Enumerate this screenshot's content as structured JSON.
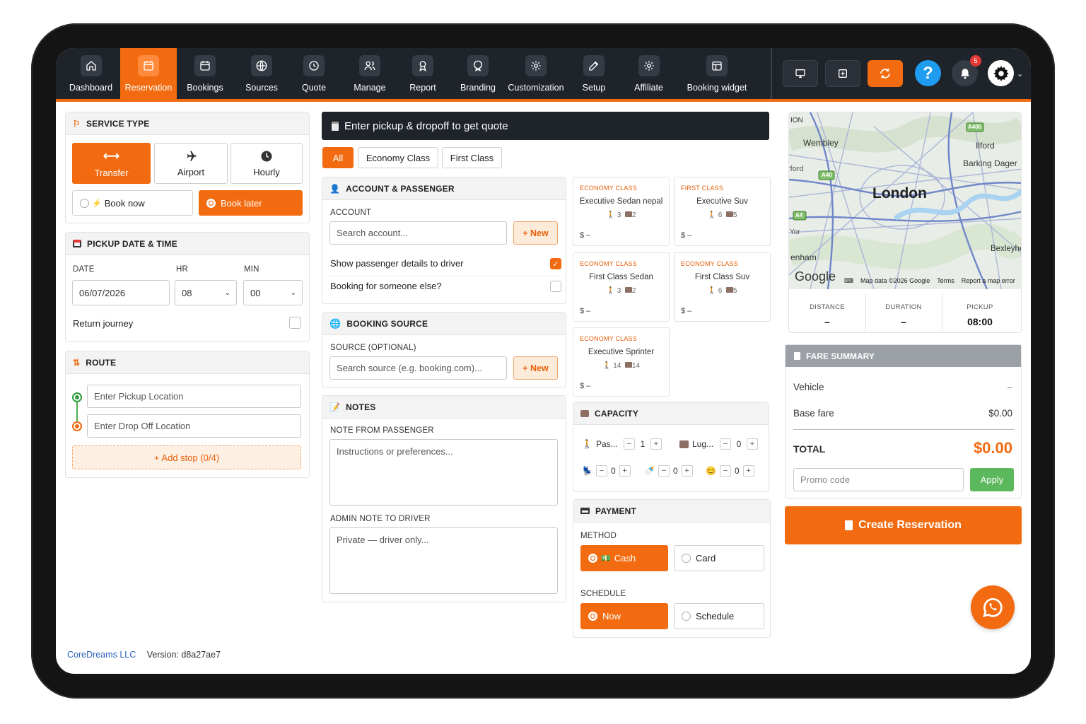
{
  "nav": {
    "items": [
      {
        "label": "Dashboard",
        "icon": "home-icon"
      },
      {
        "label": "Reservation",
        "icon": "calendar-icon",
        "active": true
      },
      {
        "label": "Bookings",
        "icon": "calendar-icon"
      },
      {
        "label": "Sources",
        "icon": "globe-icon"
      },
      {
        "label": "Quote",
        "icon": "quote-icon"
      },
      {
        "label": "Manage",
        "icon": "users-icon"
      },
      {
        "label": "Report",
        "icon": "award-icon"
      },
      {
        "label": "Branding",
        "icon": "badge-icon"
      },
      {
        "label": "Customization",
        "icon": "gear-icon"
      },
      {
        "label": "Setup",
        "icon": "edit-icon"
      },
      {
        "label": "Affiliate",
        "icon": "gear-icon"
      },
      {
        "label": "Booking widget",
        "icon": "widget-icon"
      }
    ],
    "notification_count": "5",
    "help_symbol": "?"
  },
  "service": {
    "title": "SERVICE TYPE",
    "types": [
      {
        "label": "Transfer"
      },
      {
        "label": "Airport"
      },
      {
        "label": "Hourly"
      }
    ],
    "book_now": "Book now",
    "book_later": "Book later"
  },
  "pickup": {
    "title": "PICKUP DATE & TIME",
    "date_label": "DATE",
    "hr_label": "HR",
    "min_label": "MIN",
    "date_value": "06/07/2026",
    "hr_value": "08",
    "min_value": "00",
    "return_label": "Return journey"
  },
  "route": {
    "title": "ROUTE",
    "pickup_placeholder": "Enter Pickup Location",
    "dropoff_placeholder": "Enter Drop Off Location",
    "add_stop": "+ Add stop (0/4)"
  },
  "quote_header": "Enter pickup & dropoff to get quote",
  "filters": [
    "All",
    "Economy Class",
    "First Class"
  ],
  "account": {
    "title": "ACCOUNT & PASSENGER",
    "label": "ACCOUNT",
    "placeholder": "Search account...",
    "new_label": "+ New",
    "show_details": "Show passenger details to driver",
    "someone_else": "Booking for someone else?"
  },
  "source": {
    "title": "BOOKING SOURCE",
    "label": "SOURCE (OPTIONAL)",
    "placeholder": "Search source (e.g. booking.com)...",
    "new_label": "+ New"
  },
  "notes": {
    "title": "NOTES",
    "passenger_label": "NOTE FROM PASSENGER",
    "passenger_placeholder": "Instructions or preferences...",
    "admin_label": "ADMIN NOTE TO DRIVER",
    "admin_placeholder": "Private — driver only..."
  },
  "vehicles": [
    {
      "class": "ECONOMY CLASS",
      "name": "Executive Sedan nepal",
      "pax": "3",
      "lug": "2",
      "price": "$ –"
    },
    {
      "class": "FIRST CLASS",
      "name": "Executive Suv",
      "pax": "6",
      "lug": "5",
      "price": "$ –"
    },
    {
      "class": "ECONOMY CLASS",
      "name": "First Class Sedan",
      "pax": "3",
      "lug": "2",
      "price": "$ –"
    },
    {
      "class": "ECONOMY CLASS",
      "name": "First Class Suv",
      "pax": "6",
      "lug": "5",
      "price": "$ –"
    },
    {
      "class": "ECONOMY CLASS",
      "name": "Executive Sprinter",
      "pax": "14",
      "lug": "14",
      "price": "$ –"
    }
  ],
  "capacity": {
    "title": "CAPACITY",
    "pax_label": "Pas...",
    "pax_value": "1",
    "lug_label": "Lug...",
    "lug_value": "0",
    "seat1": "0",
    "seat2": "0",
    "seat3": "0"
  },
  "payment": {
    "title": "PAYMENT",
    "method_label": "METHOD",
    "cash": "Cash",
    "card": "Card",
    "schedule_label": "SCHEDULE",
    "now": "Now",
    "schedule": "Schedule"
  },
  "map": {
    "labels": {
      "wembley": "Wembley",
      "ilford": "Ilford",
      "barking": "Barking Dager",
      "london": "London",
      "bexley": "Bexleyhe",
      "enham": "enham",
      "yor": "Yor",
      "ford": "rford",
      "top": "ION",
      "a406": "A406",
      "a40": "A40",
      "a4": "A4"
    },
    "google": "Google",
    "attribution": "Map data ©2026 Google",
    "terms": "Terms",
    "report": "Report a map error"
  },
  "trip": {
    "distance_label": "DISTANCE",
    "distance_value": "–",
    "duration_label": "DURATION",
    "duration_value": "–",
    "pickup_label": "PICKUP",
    "pickup_value": "08:00"
  },
  "fare": {
    "title": "FARE SUMMARY",
    "vehicle_label": "Vehicle",
    "vehicle_value": "–",
    "base_label": "Base fare",
    "base_value": "$0.00",
    "total_label": "TOTAL",
    "total_value": "$0.00",
    "promo_placeholder": "Promo code",
    "apply": "Apply"
  },
  "create_label": "Create Reservation",
  "footer": {
    "company": "CoreDreams LLC",
    "version": "Version: d8a27ae7"
  },
  "colors": {
    "accent": "#f26b10",
    "topbar": "#1f242b",
    "help": "#1e9cf0",
    "apply": "#5cb85c"
  }
}
